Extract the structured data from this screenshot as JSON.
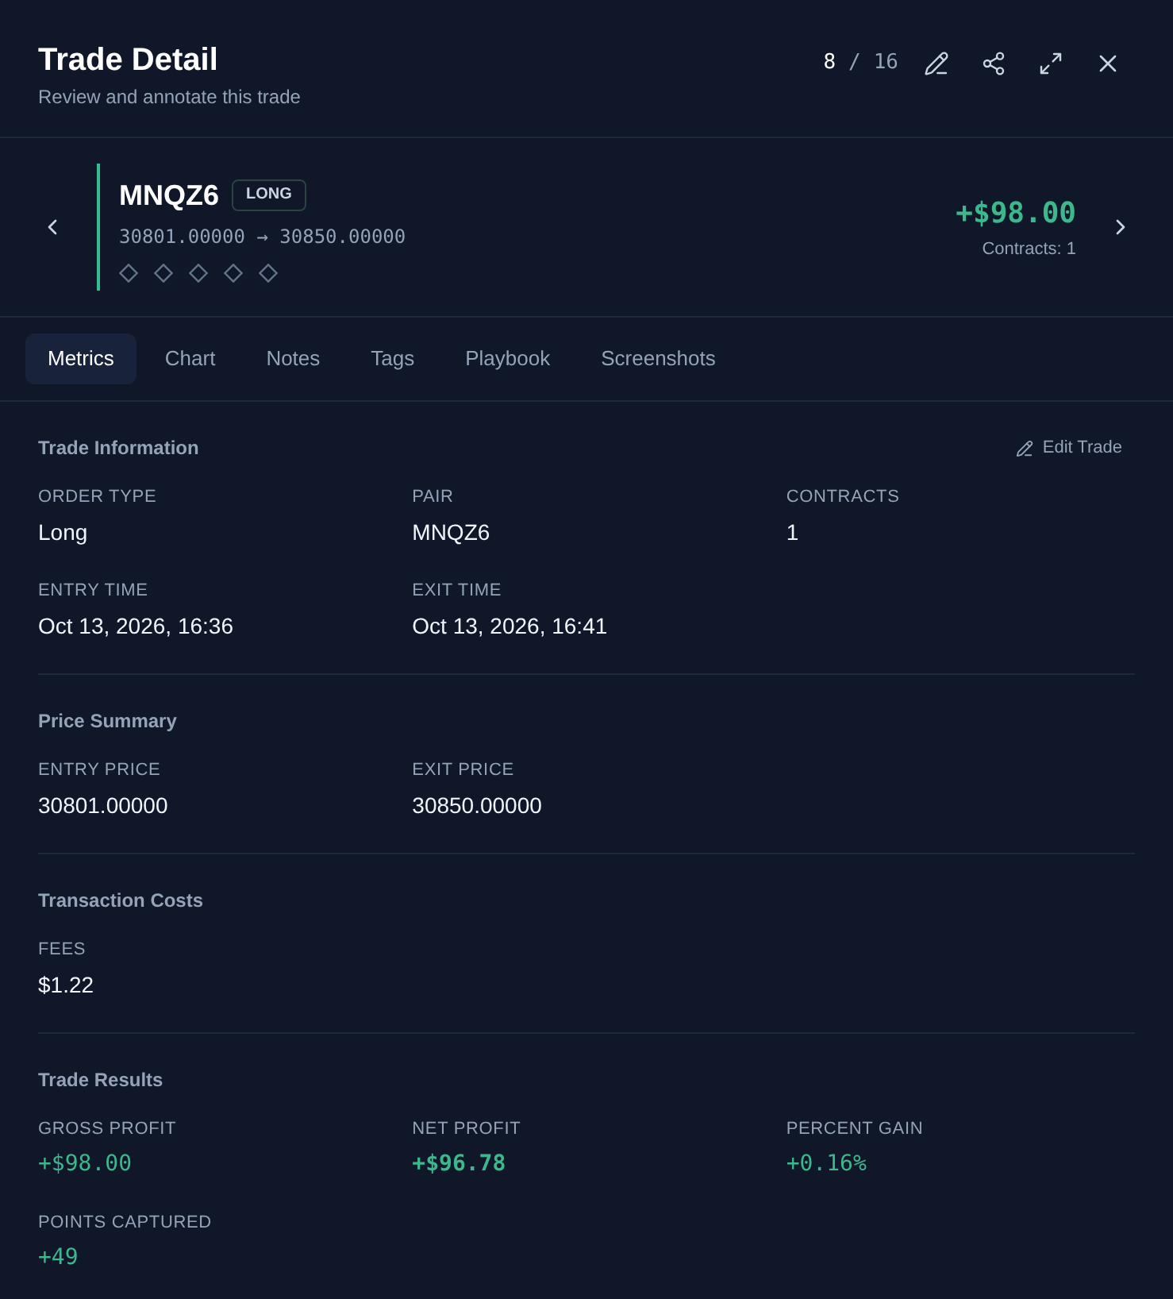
{
  "header": {
    "title": "Trade Detail",
    "subtitle": "Review and annotate this trade",
    "counter": {
      "current": "8",
      "separator": "/",
      "total": "16"
    }
  },
  "trade": {
    "symbol": "MNQZ6",
    "side": "LONG",
    "prices": "30801.00000 → 30850.00000",
    "stars": 0,
    "pnl": "+$98.00",
    "contracts": "Contracts: 1"
  },
  "tabs": [
    {
      "label": "Metrics",
      "selected": true
    },
    {
      "label": "Chart",
      "selected": false
    },
    {
      "label": "Notes",
      "selected": false
    },
    {
      "label": "Tags",
      "selected": false
    },
    {
      "label": "Playbook",
      "selected": false
    },
    {
      "label": "Screenshots",
      "selected": false
    }
  ],
  "sections": [
    {
      "title": "Trade Information",
      "action": "Edit Trade",
      "fields": [
        {
          "label": "ORDER TYPE",
          "value": "Long",
          "kind": "text"
        },
        {
          "label": "PAIR",
          "value": "MNQZ6",
          "kind": "text"
        },
        {
          "label": "CONTRACTS",
          "value": "1",
          "kind": "text"
        },
        {
          "label": "ENTRY TIME",
          "value": "Oct 13, 2026, 16:36",
          "kind": "text"
        },
        {
          "label": "EXIT TIME",
          "value": "Oct 13, 2026, 16:41",
          "kind": "text"
        }
      ]
    },
    {
      "title": "Price Summary",
      "fields": [
        {
          "label": "ENTRY PRICE",
          "value": "30801.00000",
          "kind": "text"
        },
        {
          "label": "EXIT PRICE",
          "value": "30850.00000",
          "kind": "text"
        }
      ]
    },
    {
      "title": "Transaction Costs",
      "fields": [
        {
          "label": "FEES",
          "value": "$1.22",
          "kind": "text"
        }
      ]
    },
    {
      "title": "Trade Results",
      "fields": [
        {
          "label": "GROSS PROFIT",
          "value": "+$98.00",
          "kind": "gain"
        },
        {
          "label": "NET PROFIT",
          "value": "+$96.78",
          "kind": "total"
        },
        {
          "label": "PERCENT GAIN",
          "value": "+0.16%",
          "kind": "gain"
        },
        {
          "label": "POINTS CAPTURED",
          "value": "+49",
          "kind": "gain"
        }
      ]
    }
  ]
}
